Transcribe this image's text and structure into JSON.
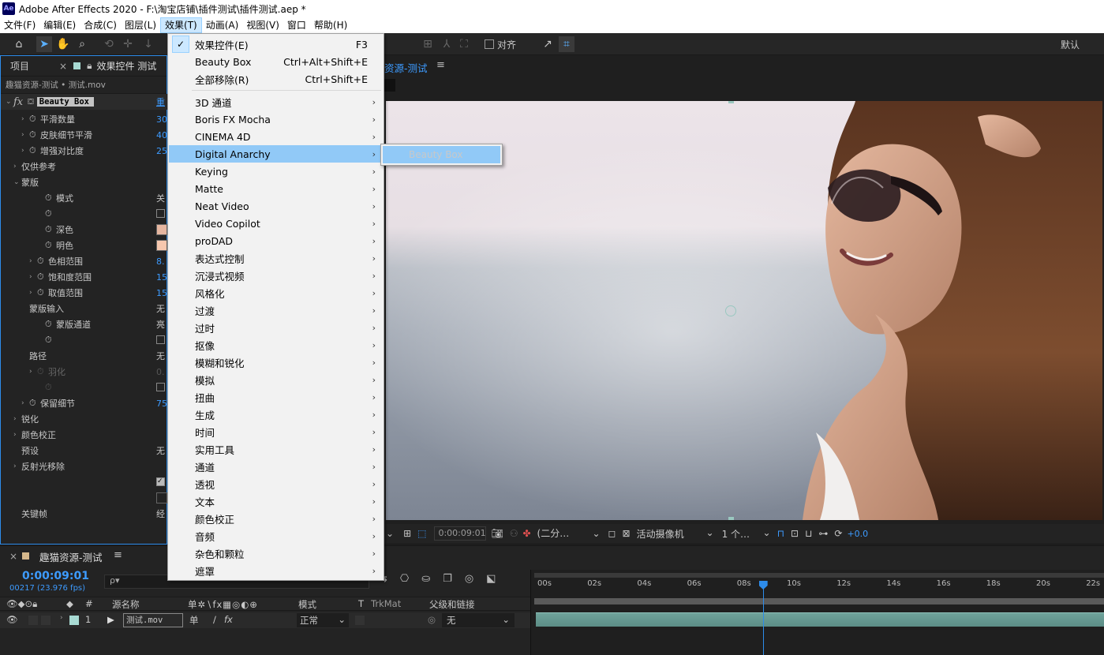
{
  "window": {
    "title": "Adobe After Effects 2020 - F:\\淘宝店铺\\插件测试\\插件测试.aep *",
    "logo": "Ae"
  },
  "menubar": [
    "文件(F)",
    "编辑(E)",
    "合成(C)",
    "图层(L)",
    "效果(T)",
    "动画(A)",
    "视图(V)",
    "窗口",
    "帮助(H)"
  ],
  "toolbar": {
    "align_label": "对齐",
    "workspace": "默认"
  },
  "left_panel": {
    "tab_project": "项目",
    "tab_effects": "效果控件 测试",
    "breadcrumb": "趣猫资源-测试 • 测试.mov",
    "fx_label": "fx",
    "effect_name": "Beauty Box",
    "effect_reset": "重",
    "rows": [
      {
        "label": "平滑数量",
        "value": "30"
      },
      {
        "label": "皮肤细节平滑",
        "value": "40"
      },
      {
        "label": "增强对比度",
        "value": "25"
      },
      {
        "label": "仅供参考",
        "value": ""
      },
      {
        "label": "蒙版",
        "value": ""
      },
      {
        "label": "模式",
        "value": "关"
      },
      {
        "label": "",
        "value": ""
      },
      {
        "label": "深色",
        "value": ""
      },
      {
        "label": "明色",
        "value": ""
      },
      {
        "label": "色相范围",
        "value": "8."
      },
      {
        "label": "饱和度范围",
        "value": "15"
      },
      {
        "label": "取值范围",
        "value": "15"
      },
      {
        "label": "蒙版输入",
        "value": "无"
      },
      {
        "label": "蒙版通道",
        "value": "亮"
      },
      {
        "label": "",
        "value": ""
      },
      {
        "label": "路径",
        "value": "无"
      },
      {
        "label": "羽化",
        "value": "0."
      },
      {
        "label": "",
        "value": ""
      },
      {
        "label": "保留细节",
        "value": "75"
      },
      {
        "label": "锐化",
        "value": ""
      },
      {
        "label": "颜色校正",
        "value": ""
      },
      {
        "label": "预设",
        "value": "无"
      },
      {
        "label": "反射光移除",
        "value": ""
      },
      {
        "label": "",
        "value": ""
      },
      {
        "label": "",
        "value": ""
      },
      {
        "label": "关键帧",
        "value": "经"
      }
    ]
  },
  "viewer": {
    "comp_tab": "资源-测试",
    "timecode": "0:00:09:01",
    "resolution": "(二分…",
    "camera": "活动摄像机",
    "views": "1 个…",
    "exposure": "+0.0"
  },
  "effect_menu": {
    "items": [
      {
        "label": "效果控件(E)",
        "shortcut": "F3",
        "checked": true
      },
      {
        "label": "Beauty Box",
        "shortcut": "Ctrl+Alt+Shift+E"
      },
      {
        "label": "全部移除(R)",
        "shortcut": "Ctrl+Shift+E"
      }
    ],
    "categories": [
      "3D 通道",
      "Boris FX Mocha",
      "CINEMA 4D",
      "Digital Anarchy",
      "Keying",
      "Matte",
      "Neat Video",
      "Video Copilot",
      "proDAD",
      "表达式控制",
      "沉浸式视频",
      "风格化",
      "过渡",
      "过时",
      "抠像",
      "模糊和锐化",
      "模拟",
      "扭曲",
      "生成",
      "时间",
      "实用工具",
      "通道",
      "透视",
      "文本",
      "颜色校正",
      "音频",
      "杂色和颗粒",
      "遮罩"
    ],
    "highlighted": "Digital Anarchy",
    "submenu": [
      "Beauty Box"
    ]
  },
  "timeline": {
    "comp_name": "趣猫资源-测试",
    "timecode": "0:00:09:01",
    "frames": "00217 (23.976 fps)",
    "search_placeholder": "ρ▾",
    "col_number": "#",
    "col_source": "源名称",
    "col_mode": "模式",
    "col_t": "T",
    "col_trkmat": "TrkMat",
    "col_parent": "父级和链接",
    "layer": {
      "index": "1",
      "name": "测试.mov",
      "mode": "正常",
      "parent": "无"
    },
    "ruler": [
      "00s",
      "02s",
      "04s",
      "06s",
      "08s",
      "10s",
      "12s",
      "14s",
      "16s",
      "18s",
      "20s",
      "22s"
    ],
    "playhead_seconds": 9.04
  }
}
